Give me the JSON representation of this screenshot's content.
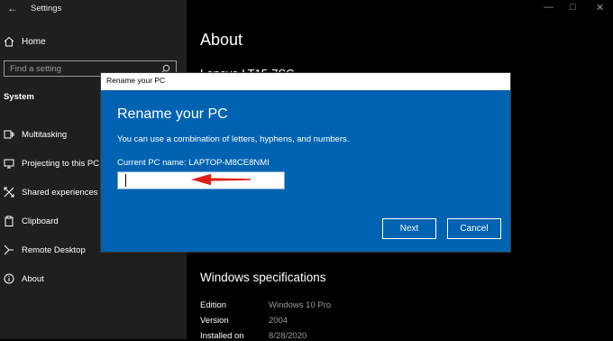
{
  "window": {
    "title": "Settings",
    "back_icon": "back-arrow-icon",
    "controls": [
      "minimize-icon",
      "maximize-icon",
      "close-icon"
    ]
  },
  "sidebar": {
    "home": {
      "label": "Home",
      "icon": "home-icon"
    },
    "search": {
      "placeholder": "Find a setting",
      "icon": "search-icon"
    },
    "section": "System",
    "items": [
      {
        "label": "Multitasking",
        "icon": "multitasking-icon"
      },
      {
        "label": "Projecting to this PC",
        "icon": "projecting-icon"
      },
      {
        "label": "Shared experiences",
        "icon": "shared-experiences-icon"
      },
      {
        "label": "Clipboard",
        "icon": "clipboard-icon"
      },
      {
        "label": "Remote Desktop",
        "icon": "remote-desktop-icon"
      },
      {
        "label": "About",
        "icon": "info-icon"
      }
    ]
  },
  "main": {
    "heading": "About",
    "pc_name_partial": "Lenovo LT15-7SC",
    "specs_heading": "Windows specifications",
    "specs": [
      {
        "label": "Edition",
        "value": "Windows 10 Pro"
      },
      {
        "label": "Version",
        "value": "2004"
      },
      {
        "label": "Installed on",
        "value": "8/28/2020"
      }
    ]
  },
  "dialog": {
    "window_title": "Rename your PC",
    "title": "Rename your PC",
    "description": "You can use a combination of letters, hyphens, and numbers.",
    "current_name": "Current PC name: LAPTOP-M8CE8NMI",
    "input_value": "",
    "next_label": "Next",
    "cancel_label": "Cancel",
    "annotation": "red-arrow-icon",
    "colors": {
      "dialog_bg": "#0063b1",
      "arrow": "#e0201c"
    }
  }
}
